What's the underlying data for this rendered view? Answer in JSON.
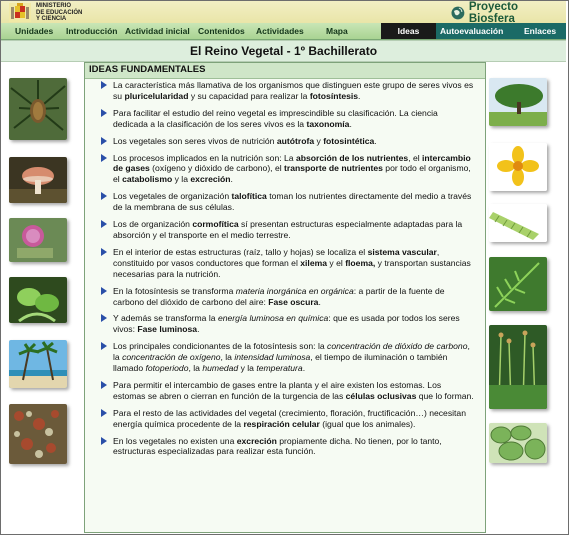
{
  "header": {
    "ministry": "MINISTERIO\nDE EDUCACIÓN\nY CIENCIA",
    "brand": "Proyecto Biosfera"
  },
  "nav": {
    "items": [
      "Unidades",
      "Introducción",
      "Actividad inicial",
      "Contenidos",
      "Actividades",
      "Mapa"
    ],
    "active_tab": "Ideas",
    "tabs": [
      "Autoevaluación",
      "Enlaces"
    ]
  },
  "page_title": "El Reino Vegetal  -  1º Bachillerato",
  "panel": {
    "heading": "IDEAS FUNDAMENTALES",
    "bullets": [
      [
        {
          "t": "La característica más llamativa de los organismos que distinguen este grupo de seres vivos es su "
        },
        {
          "t": "pluricelularidad",
          "b": true
        },
        {
          "t": " y su capacidad para realizar la "
        },
        {
          "t": "fotosíntesis",
          "b": true
        },
        {
          "t": "."
        }
      ],
      [
        {
          "t": "Para facilitar el estudio del reino vegetal es imprescindible su clasificación. La ciencia dedicada a la clasificación de los seres vivos es la "
        },
        {
          "t": "taxonomía",
          "b": true
        },
        {
          "t": "."
        }
      ],
      [
        {
          "t": "Los vegetales son seres vivos de nutrición "
        },
        {
          "t": "autótrofa",
          "b": true
        },
        {
          "t": " y "
        },
        {
          "t": "fotosintética",
          "b": true
        },
        {
          "t": "."
        }
      ],
      [
        {
          "t": "Los procesos implicados en la nutrición son: La "
        },
        {
          "t": "absorción de los nutrientes",
          "b": true
        },
        {
          "t": ", el "
        },
        {
          "t": "intercambio de gases",
          "b": true
        },
        {
          "t": " (oxígeno y dióxido de carbono), el "
        },
        {
          "t": "transporte de nutrientes",
          "b": true
        },
        {
          "t": " por todo el organismo, el "
        },
        {
          "t": "catabolismo",
          "b": true
        },
        {
          "t": " y la "
        },
        {
          "t": "excreción",
          "b": true
        },
        {
          "t": "."
        }
      ],
      [
        {
          "t": "Los vegetales de organización "
        },
        {
          "t": "talofítica",
          "b": true
        },
        {
          "t": " toman los nutrientes directamente del medio a través de la membrana de sus células."
        }
      ],
      [
        {
          "t": "Los de organización "
        },
        {
          "t": "cormofítica",
          "b": true
        },
        {
          "t": " sí presentan estructuras especialmente adaptadas para la absorción y el transporte en el medio terrestre."
        }
      ],
      [
        {
          "t": "En el interior de estas estructuras (raíz, tallo y hojas) se localiza el "
        },
        {
          "t": "sistema vascular",
          "b": true
        },
        {
          "t": ", constituido por vasos conductores que forman el "
        },
        {
          "t": "xilema",
          "b": true
        },
        {
          "t": " y el "
        },
        {
          "t": "floema,",
          "b": true
        },
        {
          "t": " y transportan sustancias necesarias para la nutrición."
        }
      ],
      [
        {
          "t": "En la fotosíntesis se transforma "
        },
        {
          "t": "materia inorgánica en orgánica",
          "i": true
        },
        {
          "t": ": a partir de la fuente de carbono del dióxido de carbono del aire: "
        },
        {
          "t": "Fase oscura",
          "b": true
        },
        {
          "t": "."
        }
      ],
      [
        {
          "t": "Y además se transforma la "
        },
        {
          "t": "energía luminosa en química",
          "i": true
        },
        {
          "t": ": que es usada por todos los seres vivos: "
        },
        {
          "t": "Fase luminosa",
          "b": true
        },
        {
          "t": "."
        }
      ],
      [
        {
          "t": "Los principales condicionantes de la fotosíntesis son: la "
        },
        {
          "t": "concentración de dióxido de carbono",
          "i": true
        },
        {
          "t": ", la "
        },
        {
          "t": "concentración de oxígeno",
          "i": true
        },
        {
          "t": ", la "
        },
        {
          "t": "intensidad luminosa",
          "i": true
        },
        {
          "t": ", el tiempo de iluminación o también llamado "
        },
        {
          "t": "fotoperiodo",
          "i": true
        },
        {
          "t": ", la "
        },
        {
          "t": "humedad",
          "i": true
        },
        {
          "t": " y la "
        },
        {
          "t": "temperatura",
          "i": true
        },
        {
          "t": "."
        }
      ],
      [
        {
          "t": "Para permitir el intercambio de gases entre la planta y el aire existen los estomas. Los estomas se abren o cierran en función de la turgencia de las "
        },
        {
          "t": "células oclusivas",
          "b": true
        },
        {
          "t": " que lo forman."
        }
      ],
      [
        {
          "t": "Para el resto de las actividades del vegetal (crecimiento, floración, fructificación…) necesitan energía química procedente de la "
        },
        {
          "t": "respiración celular",
          "b": true
        },
        {
          "t": " (igual que los animales)."
        }
      ],
      [
        {
          "t": "En los vegetales no existen una "
        },
        {
          "t": "excreción",
          "b": true
        },
        {
          "t": " propiamente dicha. No tienen, por lo tanto, estructuras especializadas para realizar esta función."
        }
      ]
    ]
  },
  "colors": {
    "nav_bg": "#a9d392",
    "tab_bg": "#1b6a66",
    "active_tab": "#1a1a1a",
    "panel_bg": "#f6fbf3",
    "bullet_arrow": "#2a4fa8"
  }
}
